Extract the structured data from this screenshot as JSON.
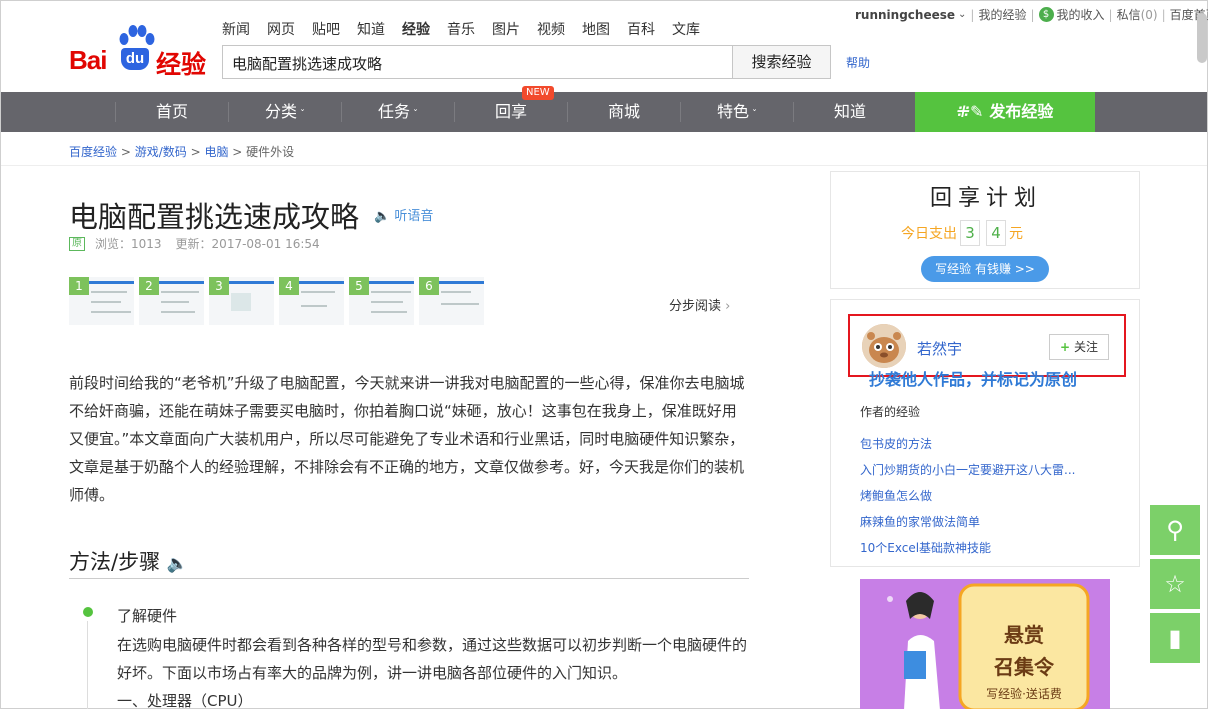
{
  "logo": {
    "bai": "Bai",
    "du": "du",
    "jy": "经验"
  },
  "topnav": [
    "新闻",
    "网页",
    "贴吧",
    "知道",
    "经验",
    "音乐",
    "图片",
    "视频",
    "地图",
    "百科",
    "文库"
  ],
  "search": {
    "value": "电脑配置挑选速成攻略",
    "button": "搜索经验",
    "help": "帮助"
  },
  "userbar": {
    "username": "runningcheese",
    "my_exp": "我的经验",
    "income": "我的收入",
    "msg": "私信",
    "msg_count": "(0)",
    "home": "百度首页"
  },
  "nav": {
    "items": [
      "首页",
      "分类",
      "任务",
      "回享",
      "商城",
      "特色",
      "知道"
    ],
    "new_badge": "NEW",
    "publish": "发布经验"
  },
  "breadcrumb": [
    "百度经验",
    "游戏/数码",
    "电脑",
    "硬件外设"
  ],
  "article": {
    "title": "电脑配置挑选速成攻略",
    "listen": "听语音",
    "badge": "原",
    "views": "浏览：1013",
    "updated": "更新：2017-08-01 16:54",
    "thumbs": [
      "1",
      "2",
      "3",
      "4",
      "5",
      "6"
    ],
    "step_read": "分步阅读",
    "intro": "前段时间给我的“老爷机”升级了电脑配置，今天就来讲一讲我对电脑配置的一些心得，保准你去电脑城不给奸商骗，还能在萌妹子需要买电脑时，你拍着胸口说“妹砸，放心！这事包在我身上，保准既好用又便宜。”本文章面向广大装机用户，所以尽可能避免了专业术语和行业黑话，同时电脑硬件知识繁杂，文章是基于奶酪个人的经验理解，不排除会有不正确的地方，文章仅做参考。好，今天我是你们的装机师傅。",
    "section": "方法/步骤",
    "step1_title": "了解硬件",
    "step1_body": "在选购电脑硬件时都会看到各种各样的型号和参数，通过这些数据可以初步判断一个电脑硬件的好坏。下面以市场占有率大的品牌为例，讲一讲电脑各部位硬件的入门知识。",
    "step1_sub": "一、处理器（CPU）"
  },
  "sidebar": {
    "huixiang_title": "回享计划",
    "today_label": "今日支出",
    "digits": [
      "3",
      "4"
    ],
    "unit": "元",
    "earn_button": "写经验 有钱赚 >>",
    "author_name": "若然宇",
    "follow": "关注",
    "annotation": "抄袭他人作品，并标记为原创",
    "author_exp_title": "作者的经验",
    "author_exps": [
      "包书皮的方法",
      "入门炒期货的小白一定要避开这八大雷...",
      "烤鲍鱼怎么做",
      "麻辣鱼的家常做法简单",
      "10个Excel基础款神技能"
    ],
    "poster": {
      "line1": "悬赏",
      "line2": "召集令",
      "line3": "写经验·送话费"
    }
  },
  "colors": {
    "nav_bg": "#65656b",
    "publish_green": "#55c33f",
    "link_blue": "#3366cc",
    "annotation_red": "#e4161f"
  }
}
